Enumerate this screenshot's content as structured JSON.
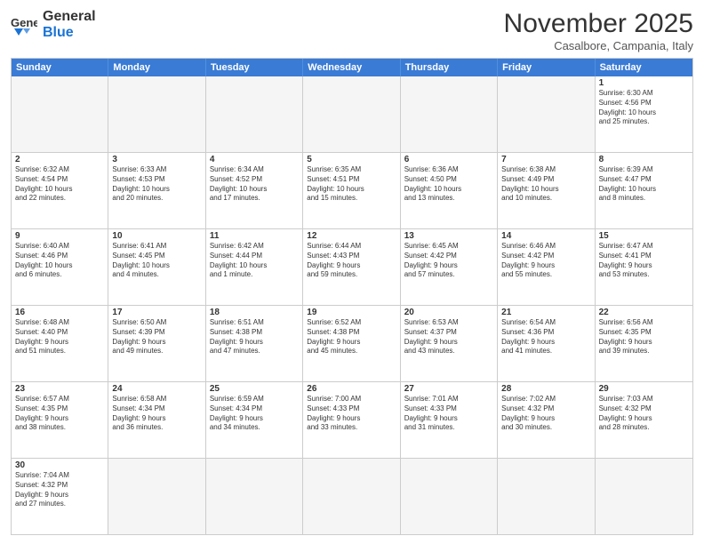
{
  "logo": {
    "text_general": "General",
    "text_blue": "Blue"
  },
  "title": "November 2025",
  "subtitle": "Casalbore, Campania, Italy",
  "header_days": [
    "Sunday",
    "Monday",
    "Tuesday",
    "Wednesday",
    "Thursday",
    "Friday",
    "Saturday"
  ],
  "rows": [
    [
      {
        "day": "",
        "text": "",
        "empty": true
      },
      {
        "day": "",
        "text": "",
        "empty": true
      },
      {
        "day": "",
        "text": "",
        "empty": true
      },
      {
        "day": "",
        "text": "",
        "empty": true
      },
      {
        "day": "",
        "text": "",
        "empty": true
      },
      {
        "day": "",
        "text": "",
        "empty": true
      },
      {
        "day": "1",
        "text": "Sunrise: 6:30 AM\nSunset: 4:56 PM\nDaylight: 10 hours\nand 25 minutes.",
        "empty": false
      }
    ],
    [
      {
        "day": "2",
        "text": "Sunrise: 6:32 AM\nSunset: 4:54 PM\nDaylight: 10 hours\nand 22 minutes.",
        "empty": false
      },
      {
        "day": "3",
        "text": "Sunrise: 6:33 AM\nSunset: 4:53 PM\nDaylight: 10 hours\nand 20 minutes.",
        "empty": false
      },
      {
        "day": "4",
        "text": "Sunrise: 6:34 AM\nSunset: 4:52 PM\nDaylight: 10 hours\nand 17 minutes.",
        "empty": false
      },
      {
        "day": "5",
        "text": "Sunrise: 6:35 AM\nSunset: 4:51 PM\nDaylight: 10 hours\nand 15 minutes.",
        "empty": false
      },
      {
        "day": "6",
        "text": "Sunrise: 6:36 AM\nSunset: 4:50 PM\nDaylight: 10 hours\nand 13 minutes.",
        "empty": false
      },
      {
        "day": "7",
        "text": "Sunrise: 6:38 AM\nSunset: 4:49 PM\nDaylight: 10 hours\nand 10 minutes.",
        "empty": false
      },
      {
        "day": "8",
        "text": "Sunrise: 6:39 AM\nSunset: 4:47 PM\nDaylight: 10 hours\nand 8 minutes.",
        "empty": false
      }
    ],
    [
      {
        "day": "9",
        "text": "Sunrise: 6:40 AM\nSunset: 4:46 PM\nDaylight: 10 hours\nand 6 minutes.",
        "empty": false
      },
      {
        "day": "10",
        "text": "Sunrise: 6:41 AM\nSunset: 4:45 PM\nDaylight: 10 hours\nand 4 minutes.",
        "empty": false
      },
      {
        "day": "11",
        "text": "Sunrise: 6:42 AM\nSunset: 4:44 PM\nDaylight: 10 hours\nand 1 minute.",
        "empty": false
      },
      {
        "day": "12",
        "text": "Sunrise: 6:44 AM\nSunset: 4:43 PM\nDaylight: 9 hours\nand 59 minutes.",
        "empty": false
      },
      {
        "day": "13",
        "text": "Sunrise: 6:45 AM\nSunset: 4:42 PM\nDaylight: 9 hours\nand 57 minutes.",
        "empty": false
      },
      {
        "day": "14",
        "text": "Sunrise: 6:46 AM\nSunset: 4:42 PM\nDaylight: 9 hours\nand 55 minutes.",
        "empty": false
      },
      {
        "day": "15",
        "text": "Sunrise: 6:47 AM\nSunset: 4:41 PM\nDaylight: 9 hours\nand 53 minutes.",
        "empty": false
      }
    ],
    [
      {
        "day": "16",
        "text": "Sunrise: 6:48 AM\nSunset: 4:40 PM\nDaylight: 9 hours\nand 51 minutes.",
        "empty": false
      },
      {
        "day": "17",
        "text": "Sunrise: 6:50 AM\nSunset: 4:39 PM\nDaylight: 9 hours\nand 49 minutes.",
        "empty": false
      },
      {
        "day": "18",
        "text": "Sunrise: 6:51 AM\nSunset: 4:38 PM\nDaylight: 9 hours\nand 47 minutes.",
        "empty": false
      },
      {
        "day": "19",
        "text": "Sunrise: 6:52 AM\nSunset: 4:38 PM\nDaylight: 9 hours\nand 45 minutes.",
        "empty": false
      },
      {
        "day": "20",
        "text": "Sunrise: 6:53 AM\nSunset: 4:37 PM\nDaylight: 9 hours\nand 43 minutes.",
        "empty": false
      },
      {
        "day": "21",
        "text": "Sunrise: 6:54 AM\nSunset: 4:36 PM\nDaylight: 9 hours\nand 41 minutes.",
        "empty": false
      },
      {
        "day": "22",
        "text": "Sunrise: 6:56 AM\nSunset: 4:35 PM\nDaylight: 9 hours\nand 39 minutes.",
        "empty": false
      }
    ],
    [
      {
        "day": "23",
        "text": "Sunrise: 6:57 AM\nSunset: 4:35 PM\nDaylight: 9 hours\nand 38 minutes.",
        "empty": false
      },
      {
        "day": "24",
        "text": "Sunrise: 6:58 AM\nSunset: 4:34 PM\nDaylight: 9 hours\nand 36 minutes.",
        "empty": false
      },
      {
        "day": "25",
        "text": "Sunrise: 6:59 AM\nSunset: 4:34 PM\nDaylight: 9 hours\nand 34 minutes.",
        "empty": false
      },
      {
        "day": "26",
        "text": "Sunrise: 7:00 AM\nSunset: 4:33 PM\nDaylight: 9 hours\nand 33 minutes.",
        "empty": false
      },
      {
        "day": "27",
        "text": "Sunrise: 7:01 AM\nSunset: 4:33 PM\nDaylight: 9 hours\nand 31 minutes.",
        "empty": false
      },
      {
        "day": "28",
        "text": "Sunrise: 7:02 AM\nSunset: 4:32 PM\nDaylight: 9 hours\nand 30 minutes.",
        "empty": false
      },
      {
        "day": "29",
        "text": "Sunrise: 7:03 AM\nSunset: 4:32 PM\nDaylight: 9 hours\nand 28 minutes.",
        "empty": false
      }
    ],
    [
      {
        "day": "30",
        "text": "Sunrise: 7:04 AM\nSunset: 4:32 PM\nDaylight: 9 hours\nand 27 minutes.",
        "empty": false
      },
      {
        "day": "",
        "text": "",
        "empty": true
      },
      {
        "day": "",
        "text": "",
        "empty": true
      },
      {
        "day": "",
        "text": "",
        "empty": true
      },
      {
        "day": "",
        "text": "",
        "empty": true
      },
      {
        "day": "",
        "text": "",
        "empty": true
      },
      {
        "day": "",
        "text": "",
        "empty": true
      }
    ]
  ]
}
